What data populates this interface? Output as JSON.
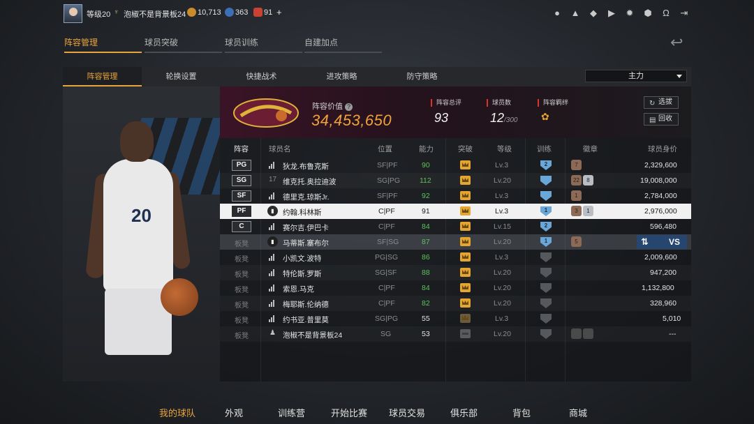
{
  "topbar": {
    "level": "等级20",
    "username": "泡椒不是背景板24",
    "coins": "10,713",
    "stars": "363",
    "tokens": "91",
    "add": "+",
    "icons": [
      "profile-icon",
      "bell-icon",
      "friends-icon",
      "video-icon",
      "settings-icon",
      "trophy-icon",
      "headset-icon",
      "exit-icon"
    ]
  },
  "main_tabs": [
    {
      "label": "阵容管理"
    },
    {
      "label": "球员突破"
    },
    {
      "label": "球员训练"
    },
    {
      "label": "自建加点"
    }
  ],
  "sub_tabs": [
    {
      "label": "阵容管理"
    },
    {
      "label": "轮换设置"
    },
    {
      "label": "快捷战术"
    },
    {
      "label": "进攻策略"
    },
    {
      "label": "防守策略"
    }
  ],
  "lineup_select": "主力",
  "summary": {
    "value_label": "阵容价值",
    "value": "34,453,650",
    "rating_label": "阵容总评",
    "rating": "93",
    "count_label": "球员数",
    "count": "12",
    "count_max": "/300",
    "bond_label": "阵容羁绊",
    "select_btn": "选拔",
    "recycle_btn": "回收"
  },
  "table_header": {
    "lineup": "阵容",
    "name": "球员名",
    "position": "位置",
    "ability": "能力",
    "breakthrough": "突破",
    "level": "等级",
    "training": "训练",
    "badges": "徽章",
    "value": "球员身价"
  },
  "players": [
    {
      "slot": "PG",
      "name": "狄龙.布鲁克斯",
      "pos": "SF|PF",
      "ability": "90",
      "level": "Lv.3",
      "train": "2",
      "badges": [
        "7"
      ],
      "value": "2,329,600"
    },
    {
      "slot": "SG",
      "name": "维克托.奥拉迪波",
      "pos": "SG|PG",
      "ability": "112",
      "level": "Lv.20",
      "train": "",
      "badges": [
        "22",
        "8"
      ],
      "value": "19,008,000",
      "num": "17"
    },
    {
      "slot": "SF",
      "name": "德里克.琼斯Jr.",
      "pos": "SF|PF",
      "ability": "92",
      "level": "Lv.3",
      "train": "",
      "badges": [
        "1"
      ],
      "value": "2,784,000"
    },
    {
      "slot": "PF",
      "name": "约翰.科林斯",
      "pos": "C|PF",
      "ability": "91",
      "level": "Lv.3",
      "train": "1",
      "badges": [
        "3",
        "1"
      ],
      "value": "2,976,000"
    },
    {
      "slot": "C",
      "name": "赛尔吉.伊巴卡",
      "pos": "C|PF",
      "ability": "84",
      "level": "Lv.15",
      "train": "2",
      "badges": [],
      "value": "596,480"
    },
    {
      "slot": "板凳",
      "name": "马蒂斯.塞布尔",
      "pos": "SF|SG",
      "ability": "87",
      "level": "Lv.20",
      "train": "1",
      "badges": [
        "5"
      ],
      "value": "",
      "vs_label": "VS"
    },
    {
      "slot": "板凳",
      "name": "小凯文.波特",
      "pos": "PG|SG",
      "ability": "86",
      "level": "Lv.3",
      "train": "",
      "badges": [],
      "value": "2,009,600"
    },
    {
      "slot": "板凳",
      "name": "特伦斯.罗斯",
      "pos": "SG|SF",
      "ability": "88",
      "level": "Lv.20",
      "train": "",
      "badges": [],
      "value": "947,200"
    },
    {
      "slot": "板凳",
      "name": "索恩.马克",
      "pos": "C|PF",
      "ability": "84",
      "level": "Lv.20",
      "train": "",
      "badges": [],
      "value": "1,132,800"
    },
    {
      "slot": "板凳",
      "name": "梅耶斯.伦纳德",
      "pos": "C|PF",
      "ability": "82",
      "level": "Lv.20",
      "train": "",
      "badges": [],
      "value": "328,960"
    },
    {
      "slot": "板凳",
      "name": "约书亚.普里莫",
      "pos": "SG|PG",
      "ability": "55",
      "level": "Lv.3",
      "train": "",
      "badges": [],
      "value": "5,010",
      "brk": "1"
    },
    {
      "slot": "板凳",
      "name": "泡椒不是背景板24",
      "pos": "SG",
      "ability": "53",
      "level": "Lv.20",
      "train": "",
      "badges": [
        "",
        ""
      ],
      "value": "---"
    }
  ],
  "bottom_nav": [
    {
      "label": "我的球队"
    },
    {
      "label": "外观"
    },
    {
      "label": "训练营"
    },
    {
      "label": "开始比赛"
    },
    {
      "label": "球员交易"
    },
    {
      "label": "俱乐部"
    },
    {
      "label": "背包"
    },
    {
      "label": "商城"
    }
  ],
  "colors": {
    "accent": "#e8a53c",
    "ability_green": "#5cc45a",
    "vs_blue": "#26456f"
  }
}
